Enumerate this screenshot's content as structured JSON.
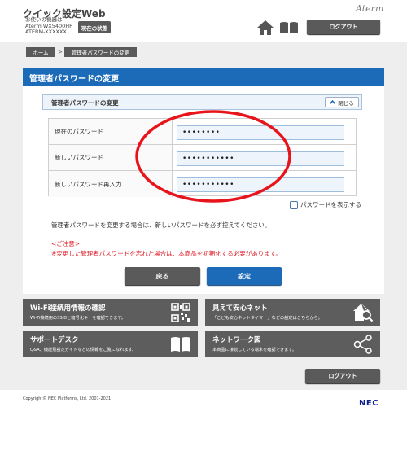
{
  "header": {
    "app_title": "クイック設定Web",
    "device_line1": "お使いの機器は",
    "device_line2": "Aterm WX5400HP",
    "device_line3": "ATERM-XXXXXX",
    "status_button": "現在の状態",
    "brand": "Aterm",
    "home_icon": "home-icon",
    "manual_icon": "book-icon",
    "logout": "ログアウト"
  },
  "breadcrumb": {
    "home": "ホーム",
    "separator": ">",
    "current": "管理者パスワードの変更"
  },
  "page": {
    "title": "管理者パスワードの変更",
    "title_color": "#1c6bb8",
    "section_title": "管理者パスワードの変更",
    "close_label": "閉じる"
  },
  "form": {
    "rows": [
      {
        "label": "現在のパスワード",
        "value": "••••••••"
      },
      {
        "label": "新しいパスワード",
        "value": "•••••••••••"
      },
      {
        "label": "新しいパスワード再入力",
        "value": "•••••••••••"
      }
    ],
    "show_password_label": "パスワードを表示する",
    "show_password_checked": false
  },
  "notes": {
    "main": "管理者パスワードを変更する場合は、新しいパスワードを必ず控えてください。",
    "caution_head": "<ご注意>",
    "caution_body": "※変更した管理者パスワードを忘れた場合は、本商品を初期化する必要があります。",
    "caution_color": "#e0202a"
  },
  "actions": {
    "back": "戻る",
    "set": "設定"
  },
  "tiles": [
    {
      "title": "Wi-Fi接続用情報の確認",
      "desc": "Wi-Fi接続用のSSIDと暗号化キーを確認できます。",
      "icon": "qr-code-icon"
    },
    {
      "title": "見えて安心ネット",
      "desc": "「こども安心ネットタイマー」などの設定はこちらから。",
      "icon": "house-search-icon"
    },
    {
      "title": "サポートデスク",
      "desc": "Q&A、機能別設定ガイドなどの情報をご覧になれます。",
      "icon": "book-icon"
    },
    {
      "title": "ネットワーク図",
      "desc": "本商品に接続している端末を確認できます。",
      "icon": "network-icon"
    }
  ],
  "footer": {
    "logout": "ログアウト",
    "copyright": "Copyright© NEC Platforms, Ltd. 2001-2021",
    "logo": "NEC"
  }
}
